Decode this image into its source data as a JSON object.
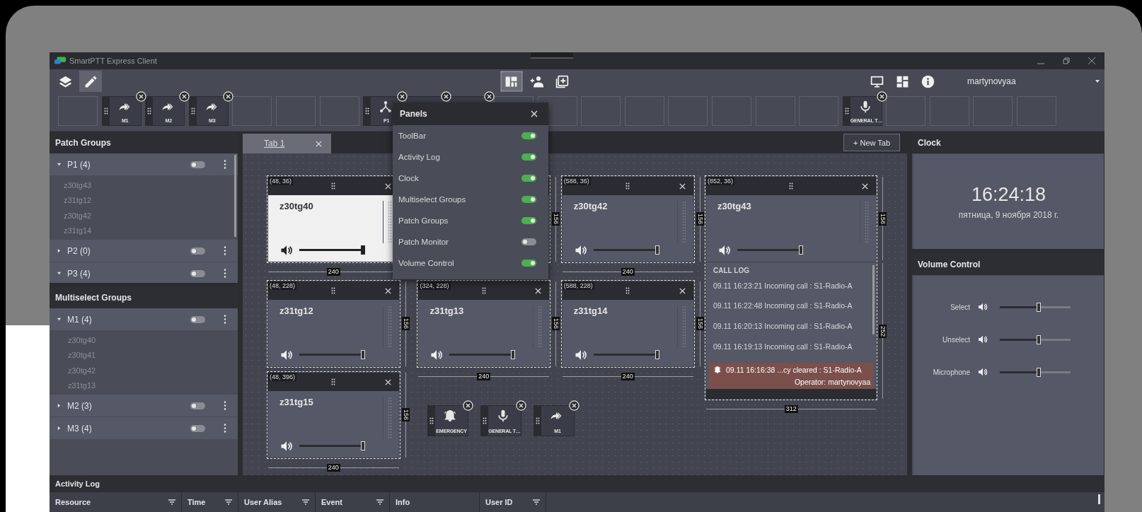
{
  "window": {
    "title": "SmartPTT Express Client"
  },
  "toolbar": {
    "left_tools": [
      {
        "kind": "layers",
        "selected": false
      },
      {
        "kind": "pencil",
        "selected": true
      }
    ],
    "center_tools": [
      {
        "kind": "layout",
        "selected": true
      },
      {
        "kind": "add-user",
        "selected": false
      },
      {
        "kind": "add-box",
        "selected": false
      }
    ],
    "right_tools": [
      {
        "kind": "monitor"
      },
      {
        "kind": "dashboard"
      },
      {
        "kind": "info"
      }
    ],
    "user": "martynovyaa"
  },
  "slots": [
    {
      "kind": "empty"
    },
    {
      "kind": "share",
      "label": "M1"
    },
    {
      "kind": "share",
      "label": "M2"
    },
    {
      "kind": "share",
      "label": "M3"
    },
    {
      "kind": "empty"
    },
    {
      "kind": "empty"
    },
    {
      "kind": "empty"
    },
    {
      "kind": "branch",
      "label": "P1"
    },
    {
      "kind": "covered"
    },
    {
      "kind": "covered"
    },
    {
      "kind": "empty"
    },
    {
      "kind": "empty"
    },
    {
      "kind": "empty"
    },
    {
      "kind": "empty"
    },
    {
      "kind": "empty"
    },
    {
      "kind": "empty"
    },
    {
      "kind": "empty"
    },
    {
      "kind": "empty"
    },
    {
      "kind": "mic",
      "label": "GENERAL T…"
    },
    {
      "kind": "empty"
    },
    {
      "kind": "empty"
    },
    {
      "kind": "empty"
    },
    {
      "kind": "empty"
    }
  ],
  "patch_groups": {
    "title": "Patch Groups",
    "groups": [
      {
        "name": "P1 (4)",
        "expanded": true,
        "on": false,
        "children": [
          "z30tg43",
          "z31tg12",
          "z30tg42",
          "z31tg14"
        ]
      },
      {
        "name": "P2 (0)",
        "expanded": false,
        "on": false
      },
      {
        "name": "P3 (4)",
        "expanded": true,
        "on": false
      }
    ]
  },
  "multiselect_groups": {
    "title": "Multiselect Groups",
    "groups": [
      {
        "name": "M1 (4)",
        "expanded": true,
        "on": false,
        "children": [
          "z30tg40",
          "z30tg41",
          "z30tg42",
          "z31tg13"
        ]
      },
      {
        "name": "M2 (3)",
        "expanded": false,
        "on": false
      },
      {
        "name": "M3 (4)",
        "expanded": false,
        "on": false
      }
    ]
  },
  "tabs": [
    {
      "label": "Tab 1",
      "selected": true
    }
  ],
  "new_tab_button": "+ New Tab",
  "widgets": [
    {
      "kind": "channel",
      "coords": "(48, 36)",
      "title": "z30tg40",
      "selected": true,
      "level": 1,
      "width_label": "240"
    },
    {
      "kind": "covered",
      "height_labels": [
        "156"
      ]
    },
    {
      "kind": "channel",
      "coords": "(588, 36)",
      "title": "z30tg42",
      "selected": false,
      "level": 1,
      "width_label": "240",
      "height_labels": [
        "156"
      ]
    },
    {
      "kind": "call_log",
      "coords": "(852, 36)",
      "title": "z30tg43",
      "selected": false,
      "level": 1,
      "width_label": "312",
      "height_labels": [
        "156",
        "252"
      ],
      "log_title": "CALL LOG",
      "entries": [
        {
          "kind": "call",
          "text": "09.11 16:23:21 Incoming call : S1-Radio-A"
        },
        {
          "kind": "call",
          "text": "09.11 16:22:48 Incoming call : S1-Radio-A"
        },
        {
          "kind": "call",
          "text": "09.11 16:20:13 Incoming call : S1-Radio-A"
        },
        {
          "kind": "call",
          "text": "09.11 16:19:13 Incoming call : S1-Radio-A"
        },
        {
          "kind": "alert",
          "text": "09.11 16:16:38 ...cy cleared : S1-Radio-A",
          "detail": "Operator: martynovyaa"
        }
      ]
    },
    {
      "kind": "channel",
      "coords": "(48, 228)",
      "title": "z31tg12",
      "selected": false,
      "level": 1,
      "height_labels": [
        "156"
      ]
    },
    {
      "kind": "channel",
      "coords": "(324, 228)",
      "title": "z31tg13",
      "selected": false,
      "level": 1,
      "width_label": "240",
      "height_labels": [
        "156"
      ]
    },
    {
      "kind": "channel",
      "coords": "(588, 228)",
      "title": "z31tg14",
      "selected": false,
      "level": 1,
      "width_label": "240",
      "height_labels": [
        "156"
      ]
    },
    {
      "kind": "channel",
      "coords": "(48, 396)",
      "title": "z31tg15",
      "selected": false,
      "level": 1,
      "width_label": "240",
      "height_labels": [
        "156"
      ]
    }
  ],
  "canvas_buttons": [
    {
      "kind": "bell",
      "label": "EMERGENCY"
    },
    {
      "kind": "mic",
      "label": "GENERAL T…"
    },
    {
      "kind": "share",
      "label": "M1"
    }
  ],
  "clock": {
    "title": "Clock",
    "time": "16:24:18",
    "date": "пятница, 9 ноября 2018 г."
  },
  "volume_control": {
    "title": "Volume Control",
    "channels": [
      {
        "name": "Select",
        "level": 0.55
      },
      {
        "name": "Unselect",
        "level": 0.55
      },
      {
        "name": "Microphone",
        "level": 0.55
      }
    ]
  },
  "activity_log": {
    "title": "Activity Log",
    "columns": [
      {
        "label": "Resource",
        "filter": true
      },
      {
        "label": "Time",
        "filter": true
      },
      {
        "label": "User Alias",
        "filter": true
      },
      {
        "label": "Event",
        "filter": true
      },
      {
        "label": "Info",
        "filter": false
      },
      {
        "label": "User ID",
        "filter": true
      }
    ]
  },
  "panels_popup": {
    "title": "Panels",
    "items": [
      {
        "label": "ToolBar",
        "on": true
      },
      {
        "label": "Activity Log",
        "on": true
      },
      {
        "label": "Clock",
        "on": true
      },
      {
        "label": "Multiselect Groups",
        "on": true
      },
      {
        "label": "Patch Groups",
        "on": true
      },
      {
        "label": "Patch Monitor",
        "on": false
      },
      {
        "label": "Volume Control",
        "on": true
      }
    ]
  }
}
